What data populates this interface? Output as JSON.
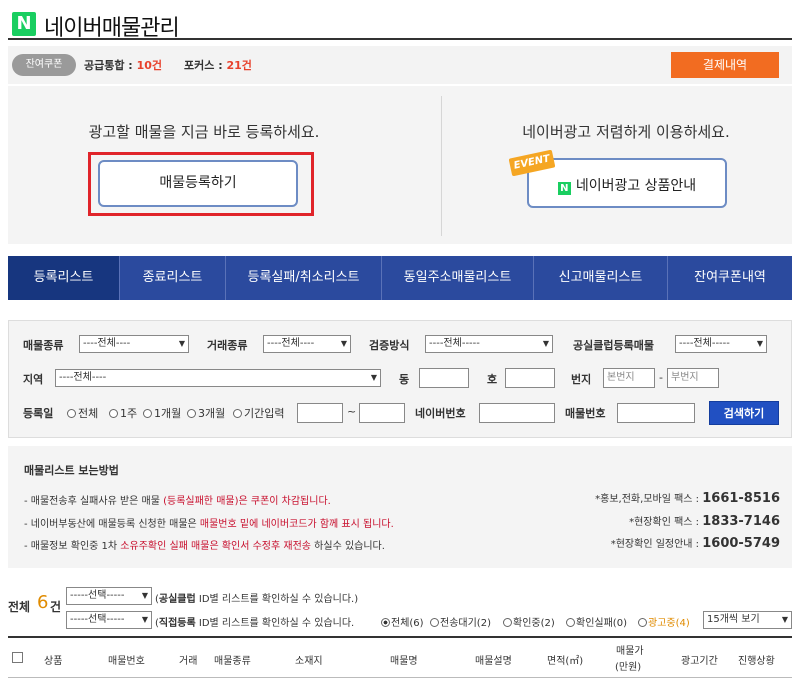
{
  "header": {
    "logo": "N",
    "title": "네이버매물관리"
  },
  "coupon_bar": {
    "badge": "잔여쿠폰",
    "stat1_label": "공급통합 :",
    "stat1_value": "10건",
    "stat2_label": "포커스 :",
    "stat2_value": "21건",
    "pay_button": "결제내역",
    "pay_color": "#f26c21"
  },
  "promo": {
    "left_text": "광고할 매물을 지금 바로 등록하세요.",
    "register_button": "매물등록하기",
    "right_text": "네이버광고 저렴하게 이용하세요.",
    "event_badge": "EVENT",
    "naver_ad_logo": "N",
    "naver_ad_button": "네이버광고 상품안내"
  },
  "tabs": [
    {
      "label": "등록리스트",
      "active": true
    },
    {
      "label": "종료리스트"
    },
    {
      "label": "등록실패/취소리스트"
    },
    {
      "label": "동일주소매물리스트"
    },
    {
      "label": "신고매물리스트"
    },
    {
      "label": "잔여쿠폰내역"
    }
  ],
  "filter": {
    "property_type_label": "매물종류",
    "property_type_value": "----전체----",
    "deal_type_label": "거래종류",
    "deal_type_value": "----전체----",
    "verify_label": "검증방식",
    "verify_value": "----전체-----",
    "club_label": "공실클럽등록매물",
    "club_value": "----전체-----",
    "region_label": "지역",
    "region_value": "----전체----",
    "dong_label": "동",
    "ho_label": "호",
    "bunji_label": "번지",
    "main_bunji_placeholder": "본번지",
    "dash": "-",
    "sub_bunji_placeholder": "부번지",
    "reg_date_label": "등록일",
    "period_options": [
      "전체",
      "1주",
      "1개월",
      "3개월",
      "기간입력"
    ],
    "tilde": "~",
    "naver_no_label": "네이버번호",
    "property_no_label": "매물번호",
    "search_button": "검색하기"
  },
  "howto": {
    "title": "매물리스트 보는방법",
    "lines": [
      {
        "prefix": "- 매물전송후 실패사유 받은 매물 ",
        "highlight": "(등록실패한 매물)은 쿠폰이 차감됩니다.",
        "suffix": ""
      },
      {
        "prefix": "- 네이버부동산에 매물등록 신청한 매물은 ",
        "highlight": "매물번호 밑에 네이버코드가 함께 표시 됩니다.",
        "suffix": ""
      },
      {
        "prefix": "- 매물정보 확인중 1차 ",
        "highlight": "소유주확인 실패 매물은 확인서 수정후 재전송",
        "suffix": " 하실수 있습니다."
      }
    ],
    "contacts": [
      {
        "label": "*홍보,전화,모바일 팩스 :",
        "number": "1661-8516"
      },
      {
        "label": "*현장확인 팩스 :",
        "number": "1833-7146"
      },
      {
        "label": "*현장확인 일정안내 :",
        "number": "1600-5749"
      }
    ]
  },
  "list": {
    "total_label": "전체",
    "total_count": "6",
    "total_unit": "건",
    "select1_value": "-----선택-----",
    "note1_prefix": "(",
    "note1_bold": "공실클럽",
    "note1_suffix": " ID별 리스트를 확인하실 수 있습니다.)",
    "select2_value": "-----선택-----",
    "note2_prefix": "(",
    "note2_bold": "직접등록",
    "note2_suffix": " ID별 리스트를 확인하실 수 있습니다.",
    "status_filters": [
      {
        "label": "전체(6)",
        "checked": true
      },
      {
        "label": "전송대기(2)"
      },
      {
        "label": "확인중(2)"
      },
      {
        "label": "확인실패(0)"
      },
      {
        "label": "광고중(4)",
        "highlight": true
      }
    ],
    "page_size_value": "15개씩 보기",
    "columns": [
      "상품",
      "매물번호",
      "거래",
      "매물종류",
      "소재지",
      "매물명",
      "매물설명",
      "면적(㎡)",
      "매물가",
      "(만원)",
      "광고기간",
      "진행상황"
    ]
  }
}
